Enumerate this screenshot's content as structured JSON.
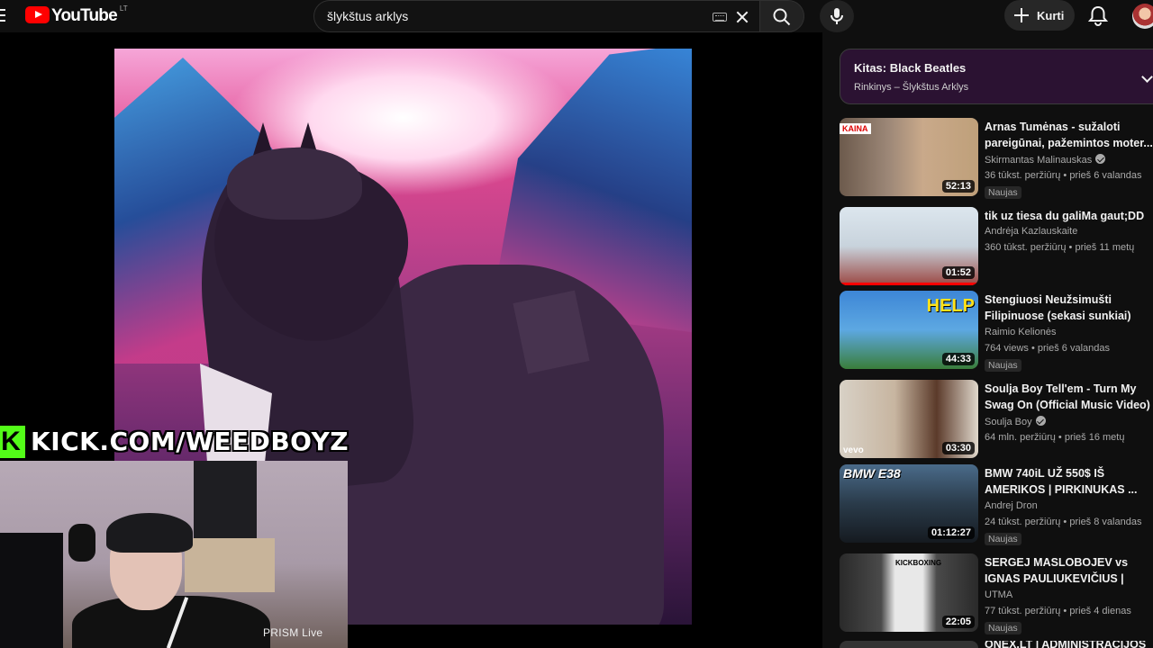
{
  "header": {
    "logo_text": "YouTube",
    "country_code": "LT",
    "search_value": "šlykštus arklys",
    "create_label": "Kurti"
  },
  "overlay": {
    "kick_url": "KICK.COM/WEEDBOYZ",
    "kick_logo": "K",
    "cam_watermark": "PRISM Live"
  },
  "queue": {
    "next_label": "Kitas: Black Beatles",
    "playlist": "Rinkinys – Šlykštus Arklys"
  },
  "recommendations": [
    {
      "title": "Arnas Tumėnas - sužaloti pareigūnai, pažemintos moter...",
      "channel": "Skirmantas Malinauskas",
      "verified": true,
      "meta": "36 tūkst. peržiūrų • prieš 6 valandas",
      "badge": "Naujas",
      "duration": "52:13",
      "thumb_text": "KAINA"
    },
    {
      "title": "tik uz tiesa du galiMa gaut;DD",
      "channel": "Andrėja Kazlauskaite",
      "verified": false,
      "meta": "360 tūkst. peržiūrų • prieš 11 metų",
      "badge": "",
      "duration": "01:52",
      "watched_fraction": 1.0
    },
    {
      "title": "Stengiuosi Neužsimušti Filipinuose (sekasi sunkiai)",
      "channel": "Raimio Kelionės",
      "verified": false,
      "meta": "764 views • prieš 6 valandas",
      "badge": "Naujas",
      "duration": "44:33",
      "thumb_text": "HELP"
    },
    {
      "title": "Soulja Boy Tell'em - Turn My Swag On (Official Music Video)",
      "channel": "Soulja Boy",
      "verified": true,
      "meta": "64 mln. peržiūrų • prieš 16 metų",
      "badge": "",
      "duration": "03:30",
      "thumb_text": "vevo"
    },
    {
      "title": "BMW 740iL UŽ 550$ IŠ AMERIKOS | PIRKINUKAS ...",
      "channel": "Andrej Dron",
      "verified": false,
      "meta": "24 tūkst. peržiūrų • prieš 8 valandas",
      "badge": "Naujas",
      "duration": "01:12:27",
      "thumb_text": "BMW E38"
    },
    {
      "title": "SERGEJ MASLOBOJEV vs IGNAS PAULIUKEVIČIUS | FUL...",
      "channel": "UTMA",
      "verified": false,
      "meta": "77 tūkst. peržiūrų • prieš 4 dienas",
      "badge": "Naujas",
      "duration": "22:05",
      "thumb_text": "KICKBOXING"
    }
  ],
  "next_partial_title": "ONEX.LT | ADMINISTRACIJOS",
  "icons": [
    "menu-icon",
    "youtube-logo-icon",
    "keyboard-icon",
    "clear-icon",
    "search-icon",
    "mic-icon",
    "plus-icon",
    "bell-icon",
    "chevron-down-icon",
    "verified-icon"
  ],
  "colors": {
    "brand_red": "#ff0000",
    "kick_green": "#53fc18",
    "queue_bg": "#2b1232"
  }
}
